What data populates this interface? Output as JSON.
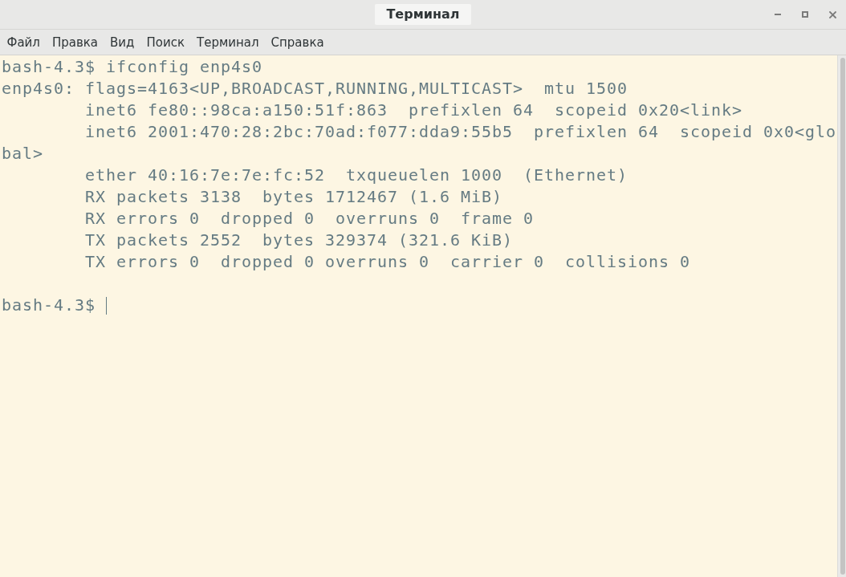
{
  "window": {
    "title": "Терминал"
  },
  "menu_bar": {
    "items": [
      "Файл",
      "Правка",
      "Вид",
      "Поиск",
      "Терминал",
      "Справка"
    ]
  },
  "terminal": {
    "lines": [
      {
        "kind": "prompt",
        "prompt": "bash-4.3$",
        "command": "ifconfig enp4s0"
      },
      {
        "kind": "output",
        "text": "enp4s0: flags=4163<UP,BROADCAST,RUNNING,MULTICAST>  mtu 1500",
        "children": [
          {
            "text": "inet6 fe80::98ca:a150:51f:863  prefixlen 64  scopeid 0x20<link>"
          },
          {
            "text": "inet6 2001:470:28:2bc:70ad:f077:dda9:55b5  prefixlen 64  scopeid 0x0<global>"
          },
          {
            "text": "ether 40:16:7e:7e:fc:52  txqueuelen 1000  (Ethernet)"
          },
          {
            "text": "RX packets 3138  bytes 1712467 (1.6 MiB)"
          },
          {
            "text": "RX errors 0  dropped 0  overruns 0  frame 0"
          },
          {
            "text": "TX packets 2552  bytes 329374 (321.6 KiB)"
          },
          {
            "text": "TX errors 0  dropped 0 overruns 0  carrier 0  collisions 0"
          }
        ]
      },
      {
        "kind": "blank"
      },
      {
        "kind": "prompt",
        "prompt": "bash-4.3$",
        "cursor": true
      }
    ]
  }
}
